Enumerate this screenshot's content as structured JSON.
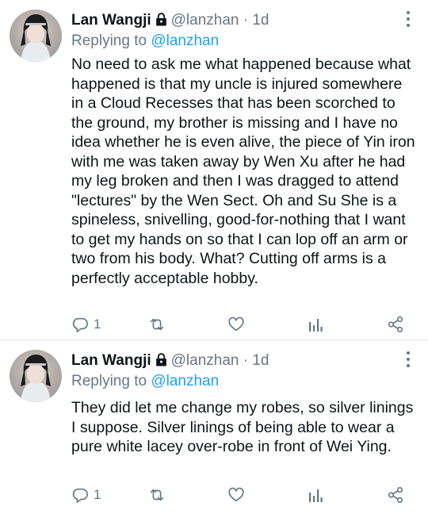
{
  "tweets": [
    {
      "author_name": "Lan Wangji",
      "handle": "@lanzhan",
      "separator": "·",
      "time": "1d",
      "replying_prefix": "Replying to",
      "replying_to": "@lanzhan",
      "text": "No need to ask me what happened because what happened is that my uncle is injured somewhere in a Cloud Recesses that has been scorched to the ground, my brother is missing and I have no idea whether he is even alive, the piece of Yin iron with me was taken away by Wen Xu after he had my leg broken and then I was dragged to attend \"lectures\" by the Wen Sect. Oh and Su She is a spineless, snivelling, good-for-nothing that I want to get my hands on so that I can lop off an arm or two from his body. What? Cutting off arms is a perfectly acceptable hobby.",
      "reply_count": "1",
      "icons": [
        "lock-icon",
        "more-icon",
        "reply-icon",
        "retweet-icon",
        "like-icon",
        "analytics-icon",
        "share-icon"
      ]
    },
    {
      "author_name": "Lan Wangji",
      "handle": "@lanzhan",
      "separator": "·",
      "time": "1d",
      "replying_prefix": "Replying to",
      "replying_to": "@lanzhan",
      "text": "They did let me change my robes, so silver linings I suppose. Silver linings of being able to wear a pure white lacey over-robe in front of Wei Ying.",
      "reply_count": "1",
      "icons": [
        "lock-icon",
        "more-icon",
        "reply-icon",
        "retweet-icon",
        "like-icon",
        "analytics-icon",
        "share-icon"
      ]
    }
  ],
  "colors": {
    "text": "#0f1419",
    "secondary": "#657786",
    "link": "#1da1f2",
    "divider": "#e1e8ed"
  }
}
